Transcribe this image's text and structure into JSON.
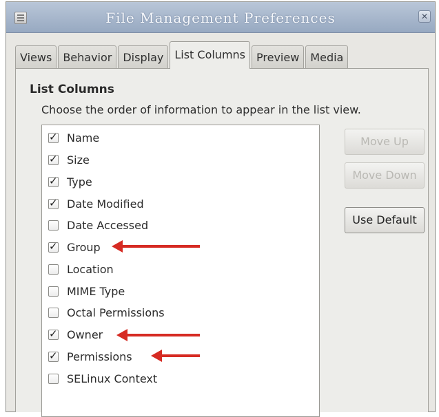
{
  "window": {
    "title": "File Management Preferences",
    "close_glyph": "✕"
  },
  "tabs": [
    {
      "label": "Views",
      "active": false
    },
    {
      "label": "Behavior",
      "active": false
    },
    {
      "label": "Display",
      "active": false
    },
    {
      "label": "List Columns",
      "active": true
    },
    {
      "label": "Preview",
      "active": false
    },
    {
      "label": "Media",
      "active": false
    }
  ],
  "list_columns": {
    "section_title": "List Columns",
    "description": "Choose the order of information to appear in the list view.",
    "items": [
      {
        "label": "Name",
        "checked": true
      },
      {
        "label": "Size",
        "checked": true
      },
      {
        "label": "Type",
        "checked": true
      },
      {
        "label": "Date Modified",
        "checked": true
      },
      {
        "label": "Date Accessed",
        "checked": false
      },
      {
        "label": "Group",
        "checked": true
      },
      {
        "label": "Location",
        "checked": false
      },
      {
        "label": "MIME Type",
        "checked": false
      },
      {
        "label": "Octal Permissions",
        "checked": false
      },
      {
        "label": "Owner",
        "checked": true
      },
      {
        "label": "Permissions",
        "checked": true
      },
      {
        "label": "SELinux Context",
        "checked": false
      }
    ]
  },
  "buttons": {
    "move_up": "Move Up",
    "move_down": "Move Down",
    "use_default": "Use Default"
  },
  "colors": {
    "annotation_arrow": "#d62b23",
    "titlebar": "#a9b8cc"
  }
}
